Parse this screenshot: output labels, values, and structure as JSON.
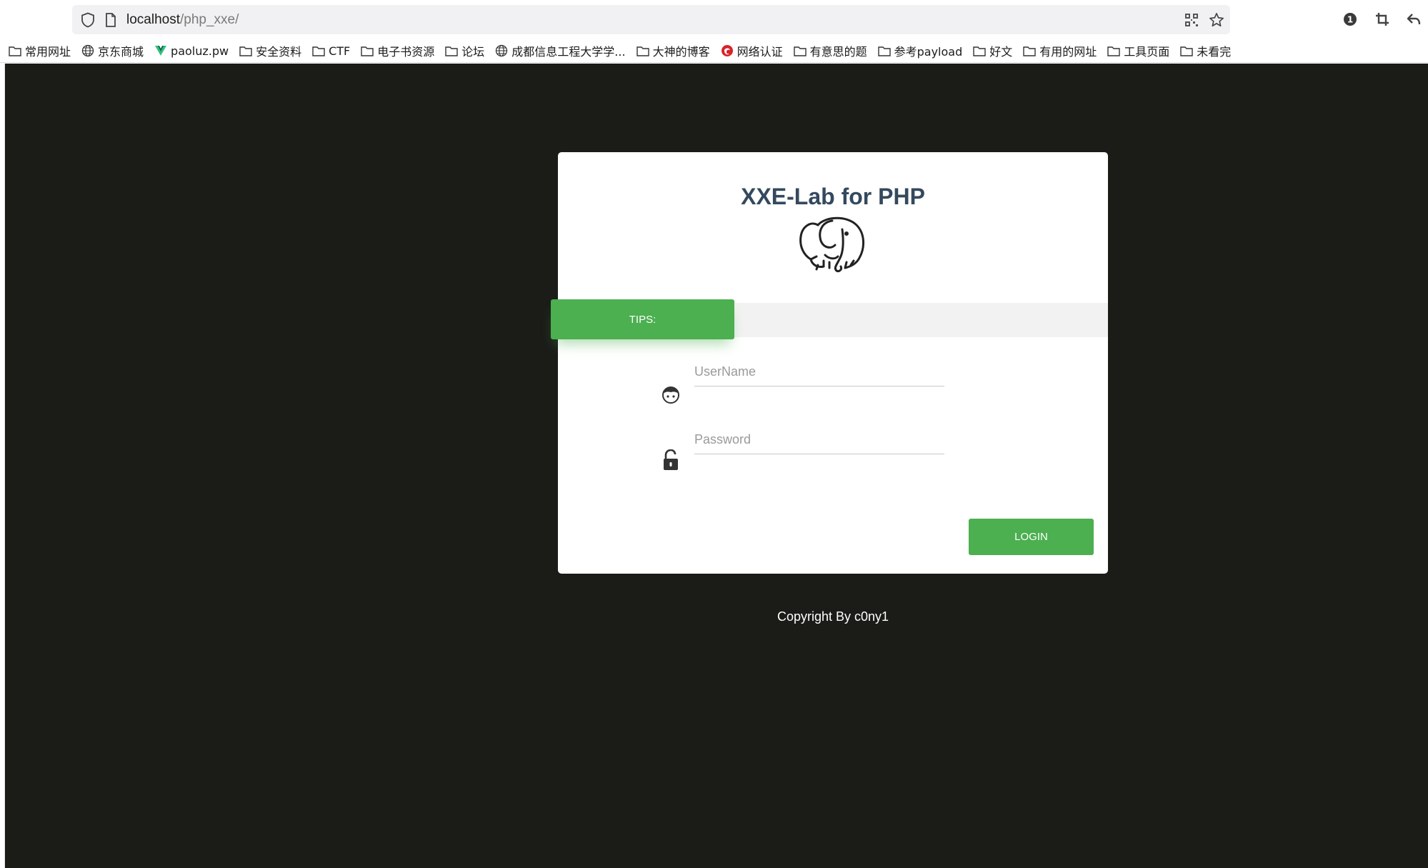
{
  "browser": {
    "url_host": "localhost",
    "url_path": "/php_xxe/",
    "icons": [
      "shield-icon",
      "page-icon",
      "qr-code-icon",
      "star-icon",
      "extension-badge-icon",
      "crop-icon",
      "back-arrow-icon"
    ],
    "extension_badge": "1"
  },
  "bookmarks": [
    {
      "label": "常用网址",
      "icon": "folder-icon"
    },
    {
      "label": "京东商城",
      "icon": "globe-icon"
    },
    {
      "label": "paoluz.pw",
      "icon": "v-logo-icon"
    },
    {
      "label": "安全资料",
      "icon": "folder-icon"
    },
    {
      "label": "CTF",
      "icon": "folder-icon"
    },
    {
      "label": "电子书资源",
      "icon": "folder-icon"
    },
    {
      "label": "论坛",
      "icon": "folder-icon"
    },
    {
      "label": "成都信息工程大学学...",
      "icon": "globe-icon"
    },
    {
      "label": "大神的博客",
      "icon": "folder-icon"
    },
    {
      "label": "网络认证",
      "icon": "red-logo-icon"
    },
    {
      "label": "有意思的题",
      "icon": "folder-icon"
    },
    {
      "label": "参考payload",
      "icon": "folder-icon"
    },
    {
      "label": "好文",
      "icon": "folder-icon"
    },
    {
      "label": "有用的网址",
      "icon": "folder-icon"
    },
    {
      "label": "工具页面",
      "icon": "folder-icon"
    },
    {
      "label": "未看完",
      "icon": "folder-icon"
    }
  ],
  "login": {
    "title": "XXE-Lab for PHP",
    "logo_icon": "elephant-icon",
    "tips_label": "TIPS:",
    "username_placeholder": "UserName",
    "password_placeholder": "Password",
    "username_icon": "face-icon",
    "password_icon": "lock-icon",
    "login_label": "LOGIN",
    "accent_color": "#4caf50",
    "title_color": "#34495e"
  },
  "footer": {
    "copyright": "Copyright By c0ny1"
  },
  "colors": {
    "page_background": "#1b1c18"
  }
}
